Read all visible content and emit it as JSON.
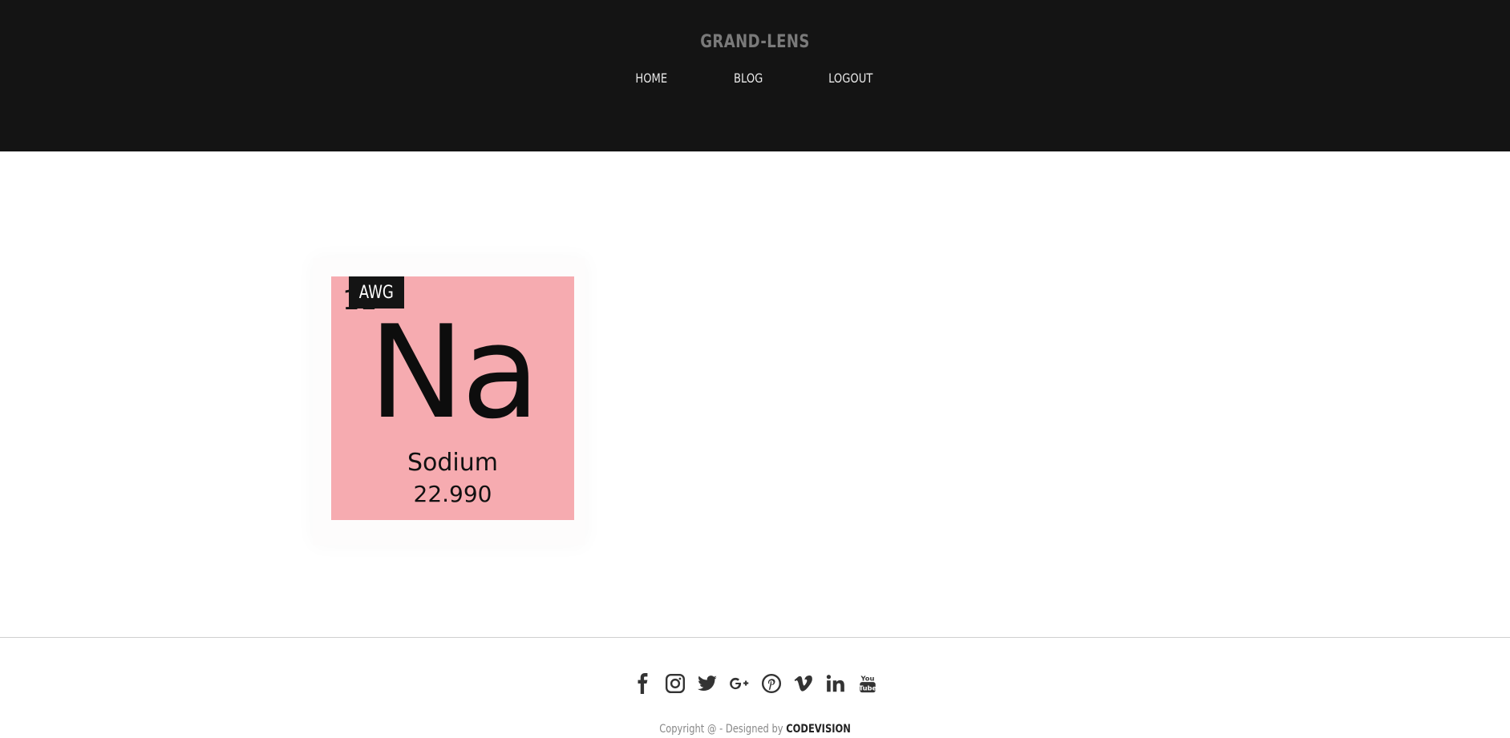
{
  "header": {
    "brand": "GRAND-LENS",
    "nav": [
      {
        "label": "HOME"
      },
      {
        "label": "BLOG"
      },
      {
        "label": "LOGOUT"
      }
    ]
  },
  "gallery": {
    "item": {
      "tag": "AWG",
      "atomic_number": "11",
      "symbol": "Na",
      "name": "Sodium",
      "mass": "22.990",
      "tile_color": "#f6abb0"
    }
  },
  "footer": {
    "social_icons": [
      "facebook-icon",
      "instagram-icon",
      "twitter-icon",
      "google-plus-icon",
      "pinterest-icon",
      "vimeo-icon",
      "linkedin-icon",
      "youtube-icon"
    ],
    "copyright_prefix": "Copyright @ - Designed by",
    "designer": "CODEVISION"
  }
}
